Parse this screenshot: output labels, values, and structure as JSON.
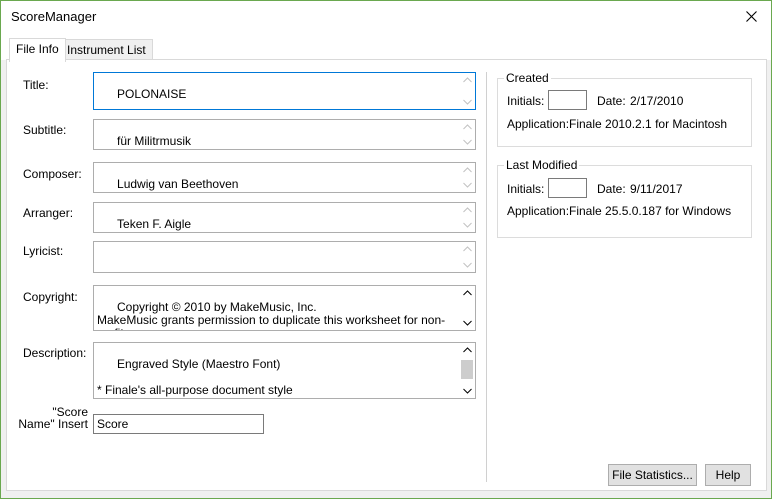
{
  "window": {
    "title": "ScoreManager"
  },
  "tabs": [
    {
      "label": "File Info",
      "active": true
    },
    {
      "label": "Instrument List",
      "active": false
    }
  ],
  "fields": {
    "title": {
      "label": "Title:",
      "value": "POLONAISE"
    },
    "subtitle": {
      "label": "Subtitle:",
      "value": "für Militrmusik"
    },
    "composer": {
      "label": "Composer:",
      "value": "Ludwig van Beethoven"
    },
    "arranger": {
      "label": "Arranger:",
      "value": "Teken F. Aigle"
    },
    "lyricist": {
      "label": "Lyricist:",
      "value": ""
    },
    "copyright": {
      "label": "Copyright:",
      "value": "Copyright © 2010 by MakeMusic, Inc.\nMakeMusic grants permission to duplicate this worksheet for non-profit,\neducational use only, provided each copy includes this copyright notice."
    },
    "description": {
      "label": "Description:",
      "value": "Engraved Style (Maestro Font)\n\n* Finale's all-purpose document style"
    },
    "score_name_insert": {
      "label": "\"Score\nName\" Insert",
      "value": "Score"
    }
  },
  "created": {
    "title": "Created",
    "initials_label": "Initials:",
    "initials_value": "",
    "date_label": "Date:",
    "date_value": "2/17/2010",
    "application_label": "Application:",
    "application_value": "Finale 2010.2.1 for Macintosh"
  },
  "last_modified": {
    "title": "Last Modified",
    "initials_label": "Initials:",
    "initials_value": "",
    "date_label": "Date:",
    "date_value": "9/11/2017",
    "application_label": "Application:",
    "application_value": "Finale 25.5.0.187 for Windows"
  },
  "buttons": {
    "file_statistics": "File Statistics...",
    "help": "Help"
  },
  "icons": {
    "close": "close-icon",
    "scroll_up": "chevron-up-icon",
    "scroll_down": "chevron-down-icon"
  },
  "colors": {
    "window_border": "#6aa84f",
    "focus_border": "#0078d7"
  }
}
